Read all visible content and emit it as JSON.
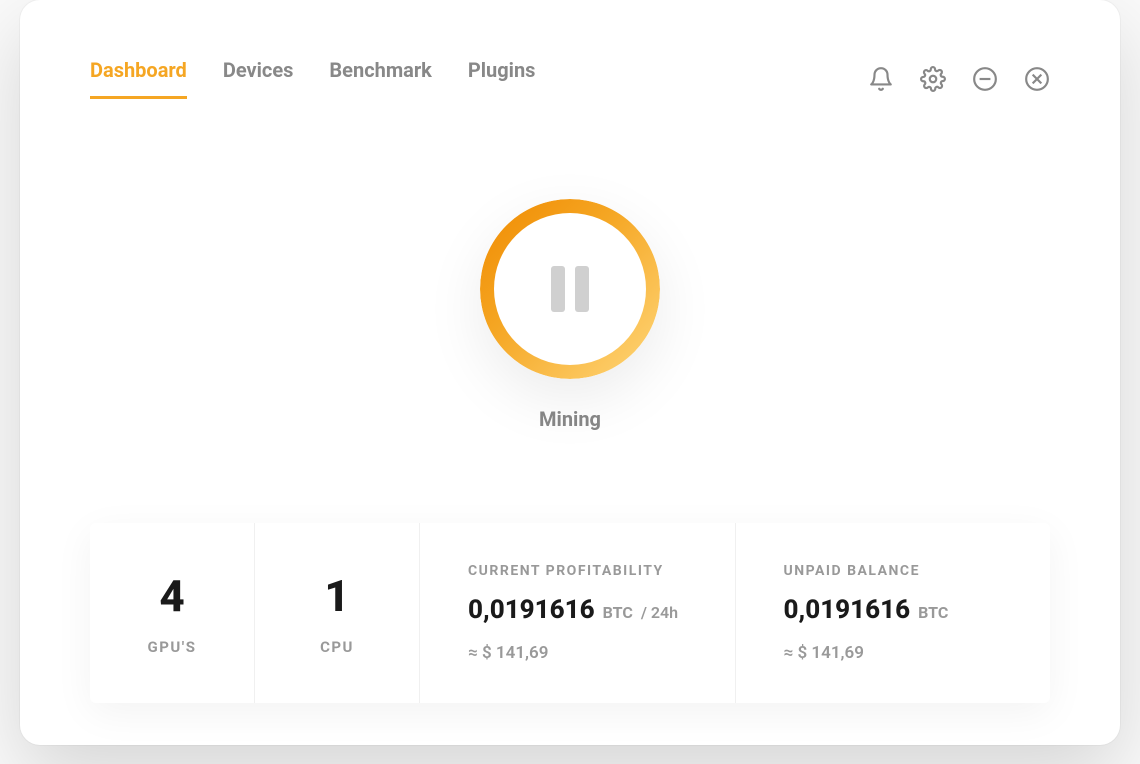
{
  "tabs": [
    {
      "label": "Dashboard",
      "active": true
    },
    {
      "label": "Devices",
      "active": false
    },
    {
      "label": "Benchmark",
      "active": false
    },
    {
      "label": "Plugins",
      "active": false
    }
  ],
  "status": {
    "label": "Mining"
  },
  "stats": {
    "gpu": {
      "count": "4",
      "label": "GPU'S"
    },
    "cpu": {
      "count": "1",
      "label": "CPU"
    },
    "profitability": {
      "title": "CURRENT PROFITABILITY",
      "value": "0,0191616",
      "unit": "BTC",
      "per": "/ 24h",
      "approx": "≈ $ 141,69"
    },
    "unpaid": {
      "title": "UNPAID BALANCE",
      "value": "0,0191616",
      "unit": "BTC",
      "approx": "≈ $ 141,69"
    }
  },
  "colors": {
    "accent": "#f5a623"
  }
}
